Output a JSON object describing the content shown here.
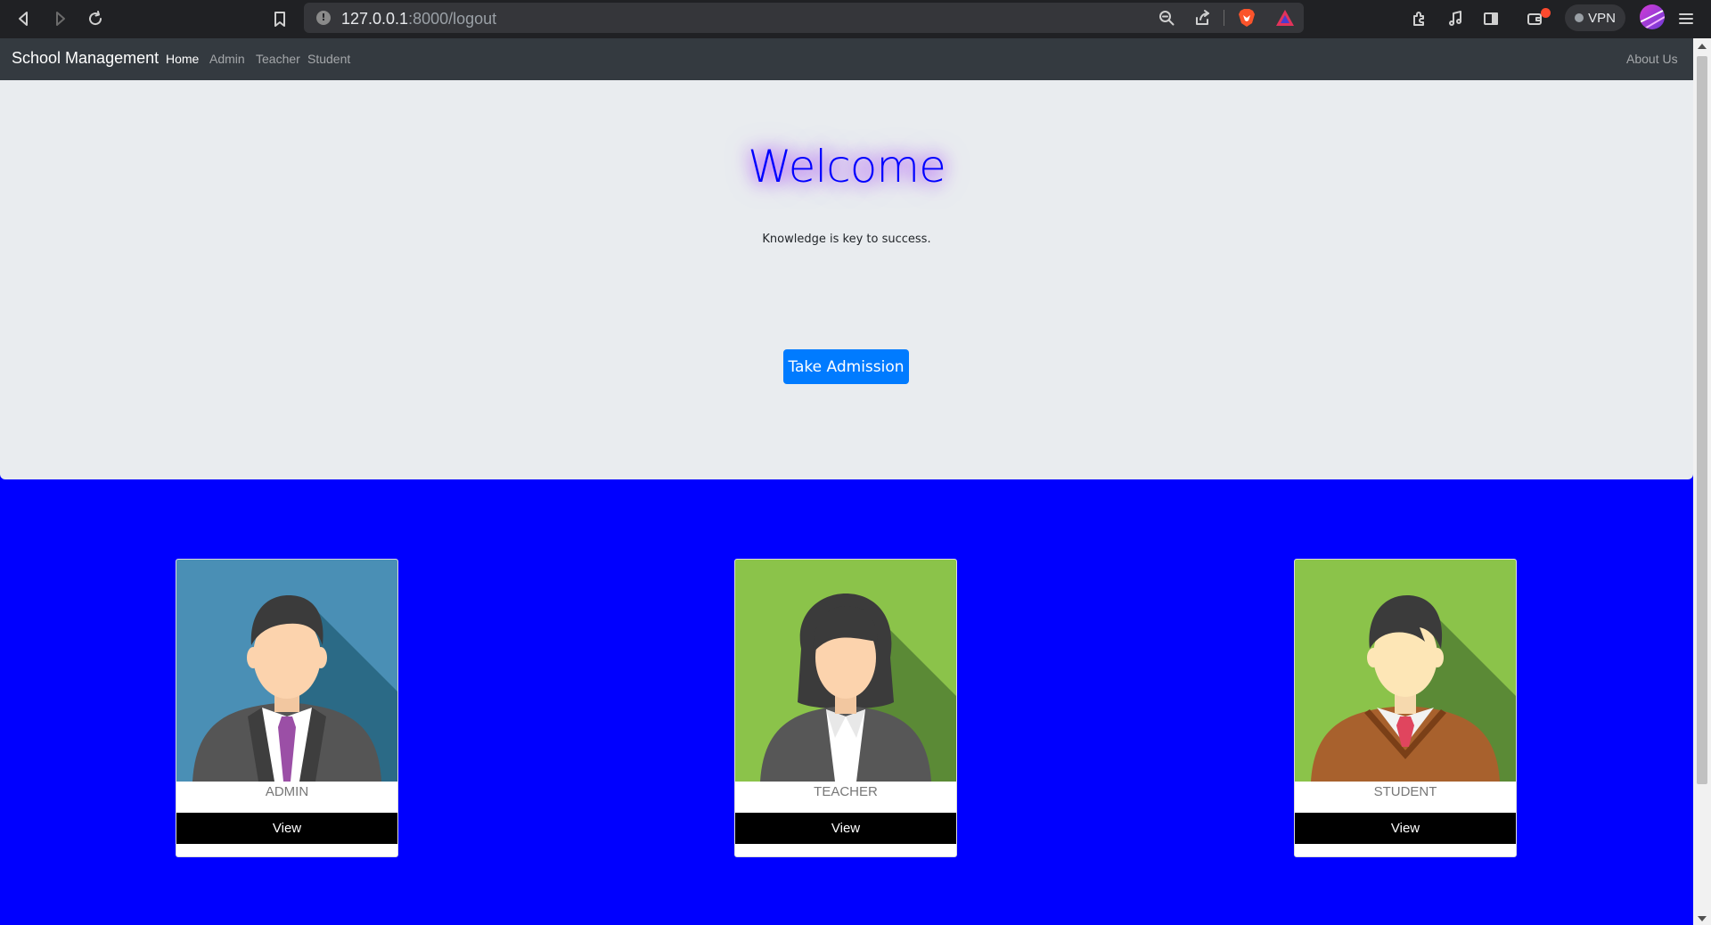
{
  "browser": {
    "url_host": "127.0.0.1",
    "url_path": ":8000/logout",
    "vpn_label": "VPN"
  },
  "navbar": {
    "brand": "School Management",
    "links": [
      {
        "label": "Home",
        "active": true
      },
      {
        "label": "Admin",
        "active": false
      },
      {
        "label": "Teacher",
        "active": false
      },
      {
        "label": "Student",
        "active": false
      }
    ],
    "about": "About Us"
  },
  "hero": {
    "title": "Welcome",
    "tagline": "Knowledge is key to success.",
    "button_label": "Take Admission"
  },
  "cards": [
    {
      "title": "ADMIN",
      "button_label": "View",
      "bg_color": "#4a8fb5",
      "icon": "businessman-avatar-icon"
    },
    {
      "title": "TEACHER",
      "button_label": "View",
      "bg_color": "#8bc34a",
      "icon": "businesswoman-avatar-icon"
    },
    {
      "title": "STUDENT",
      "button_label": "View",
      "bg_color": "#8bc34a",
      "icon": "student-avatar-icon"
    }
  ],
  "colors": {
    "page_bg": "#0000ff",
    "navbar_bg": "#343a40",
    "jumbotron_bg": "#e9ecef",
    "primary_button": "#007bff",
    "card_button": "#000000"
  }
}
